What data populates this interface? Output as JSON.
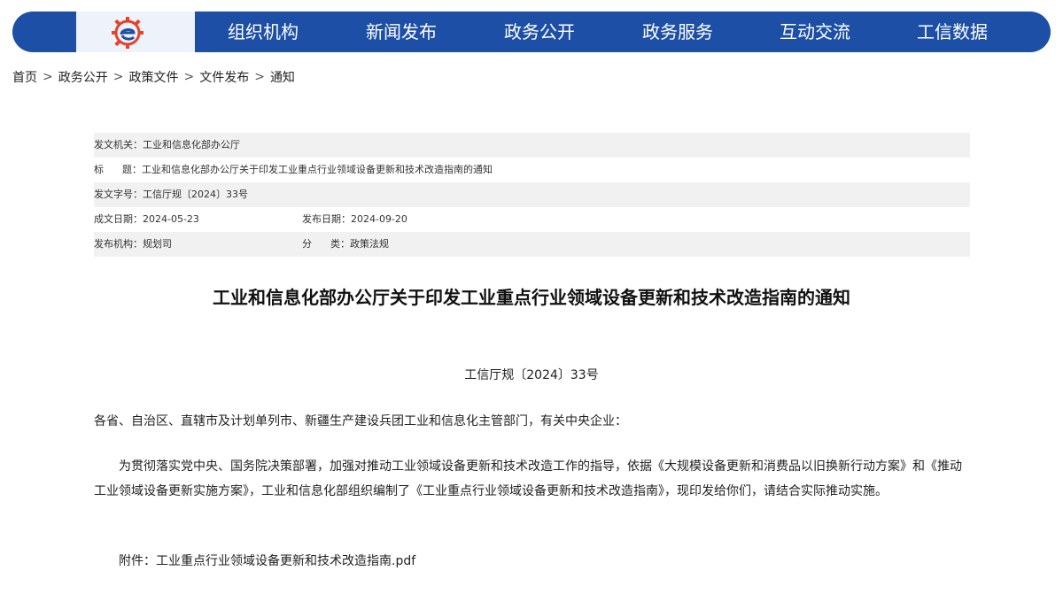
{
  "colors": {
    "nav_bg": "#1d4fa6",
    "logo_bg": "#eef3fb",
    "meta_shade": "#f1f1f1"
  },
  "logo": {
    "icon": "ministry-logo-icon"
  },
  "nav": {
    "items": [
      "组织机构",
      "新闻发布",
      "政务公开",
      "政务服务",
      "互动交流",
      "工信数据"
    ]
  },
  "breadcrumb": {
    "items": [
      "首页",
      "政务公开",
      "政策文件",
      "文件发布",
      "通知"
    ],
    "separator": ">"
  },
  "meta": {
    "issuer_label": "发文机关：",
    "issuer": "工业和信息化部办公厅",
    "title_label": "标      题：",
    "title": "工业和信息化部办公厅关于印发工业重点行业领域设备更新和技术改造指南的通知",
    "docno_label": "发文字号：",
    "docno": "工信厅规〔2024〕33号",
    "created_label": "成文日期：",
    "created": "2024-05-23",
    "published_label": "发布日期：",
    "published": "2024-09-20",
    "agency_label": "发布机构：",
    "agency": "规划司",
    "category_label": "分      类：",
    "category": "政策法规"
  },
  "article": {
    "title": "工业和信息化部办公厅关于印发工业重点行业领域设备更新和技术改造指南的通知",
    "docno": "工信厅规〔2024〕33号",
    "salutation": "各省、自治区、直辖市及计划单列市、新疆生产建设兵团工业和信息化主管部门，有关中央企业：",
    "body": "为贯彻落实党中央、国务院决策部署，加强对推动工业领域设备更新和技术改造工作的指导，依据《大规模设备更新和消费品以旧换新行动方案》和《推动工业领域设备更新实施方案》，工业和信息化部组织编制了《工业重点行业领域设备更新和技术改造指南》，现印发给你们，请结合实际推动实施。",
    "attachment_label": "附件：",
    "attachment_file": "工业重点行业领域设备更新和技术改造指南.pdf"
  }
}
